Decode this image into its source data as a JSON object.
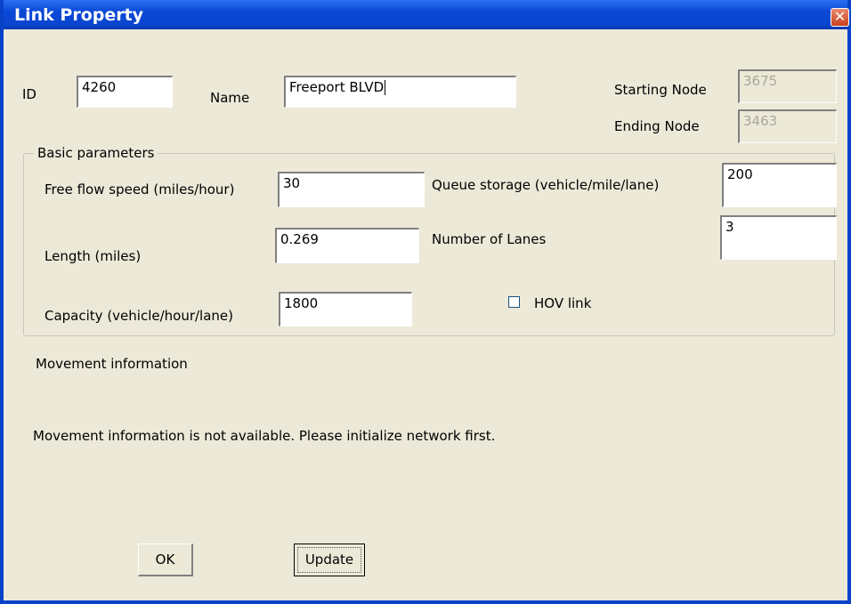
{
  "window": {
    "title": "Link Property"
  },
  "fields": {
    "id": {
      "label": "ID",
      "value": "4260"
    },
    "name": {
      "label": "Name",
      "value": "Freeport BLVD"
    },
    "starting_node": {
      "label": "Starting Node",
      "value": "3675"
    },
    "ending_node": {
      "label": "Ending Node",
      "value": "3463"
    }
  },
  "basic": {
    "title": "Basic parameters",
    "free_flow_speed": {
      "label": "Free flow speed (miles/hour)",
      "value": "30"
    },
    "length": {
      "label": "Length (miles)",
      "value": "0.269"
    },
    "capacity": {
      "label": "Capacity (vehicle/hour/lane)",
      "value": "1800"
    },
    "queue_storage": {
      "label": "Queue storage (vehicle/mile/lane)",
      "value": "200"
    },
    "number_of_lanes": {
      "label": "Number of Lanes",
      "value": "3"
    },
    "hov_link": {
      "label": "HOV link",
      "checked": false
    }
  },
  "movement": {
    "title": "Movement information",
    "message": "Movement information is not available. Please initialize network first."
  },
  "buttons": {
    "ok": "OK",
    "update": "Update"
  },
  "colors": {
    "titlebar": "#0a46cf",
    "dialog_bg": "#ece9d8",
    "close": "#c8401e"
  },
  "icons": {
    "close": "close-icon"
  }
}
